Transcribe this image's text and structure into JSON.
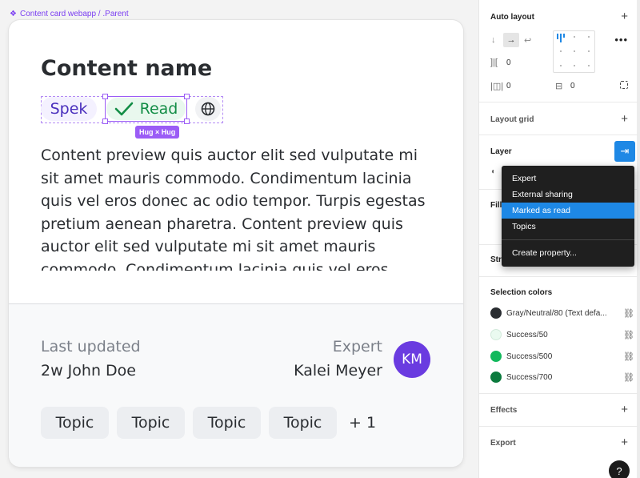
{
  "canvas": {
    "frame_label": "Content card webapp / .Parent",
    "component_glyph": "❖"
  },
  "card": {
    "title": "Content name",
    "tags": {
      "spek": "Spek",
      "read": "Read",
      "read_icon": "checkmark-icon",
      "globe_icon": "globe-icon"
    },
    "hug_badge": "Hug × Hug",
    "preview": "Content preview quis auctor elit sed vulputate mi sit amet mauris commodo. Condimentum lacinia quis vel eros donec ac odio tempor. Turpis egestas pretium aenean pharetra. Content preview quis auctor elit sed vulputate mi sit amet mauris commodo. Condimentum lacinia quis vel eros",
    "footer": {
      "updated_label": "Last updated",
      "updated_value": "2w John Doe",
      "expert_label": "Expert",
      "expert_value": "Kalei Meyer",
      "avatar_initials": "KM",
      "topics": [
        "Topic",
        "Topic",
        "Topic",
        "Topic"
      ],
      "topics_more": "+ 1"
    }
  },
  "panel": {
    "auto_layout": {
      "title": "Auto layout",
      "spacing_between": "0",
      "padding_horizontal": "0",
      "padding_vertical": "0",
      "direction": "horizontal"
    },
    "layout_grid": {
      "title": "Layout grid"
    },
    "layer": {
      "title": "Layer"
    },
    "fill": {
      "title": "Fill"
    },
    "stroke": {
      "title": "Str"
    },
    "dropdown": {
      "items": [
        "Expert",
        "External sharing",
        "Marked as read",
        "Topics"
      ],
      "active_index": 2,
      "create_label": "Create property..."
    },
    "selection_colors": {
      "title": "Selection colors",
      "items": [
        {
          "name": "Gray/Neutral/80 (Text defa...",
          "color": "#2a2d31"
        },
        {
          "name": "Success/50",
          "color": "#eafaf0"
        },
        {
          "name": "Success/500",
          "color": "#12b85c"
        },
        {
          "name": "Success/700",
          "color": "#0b7a3d"
        }
      ]
    },
    "effects": {
      "title": "Effects"
    },
    "export": {
      "title": "Export"
    },
    "help": "?",
    "accent": "#1e88e5",
    "selection_accent": "#9b5cf6"
  }
}
